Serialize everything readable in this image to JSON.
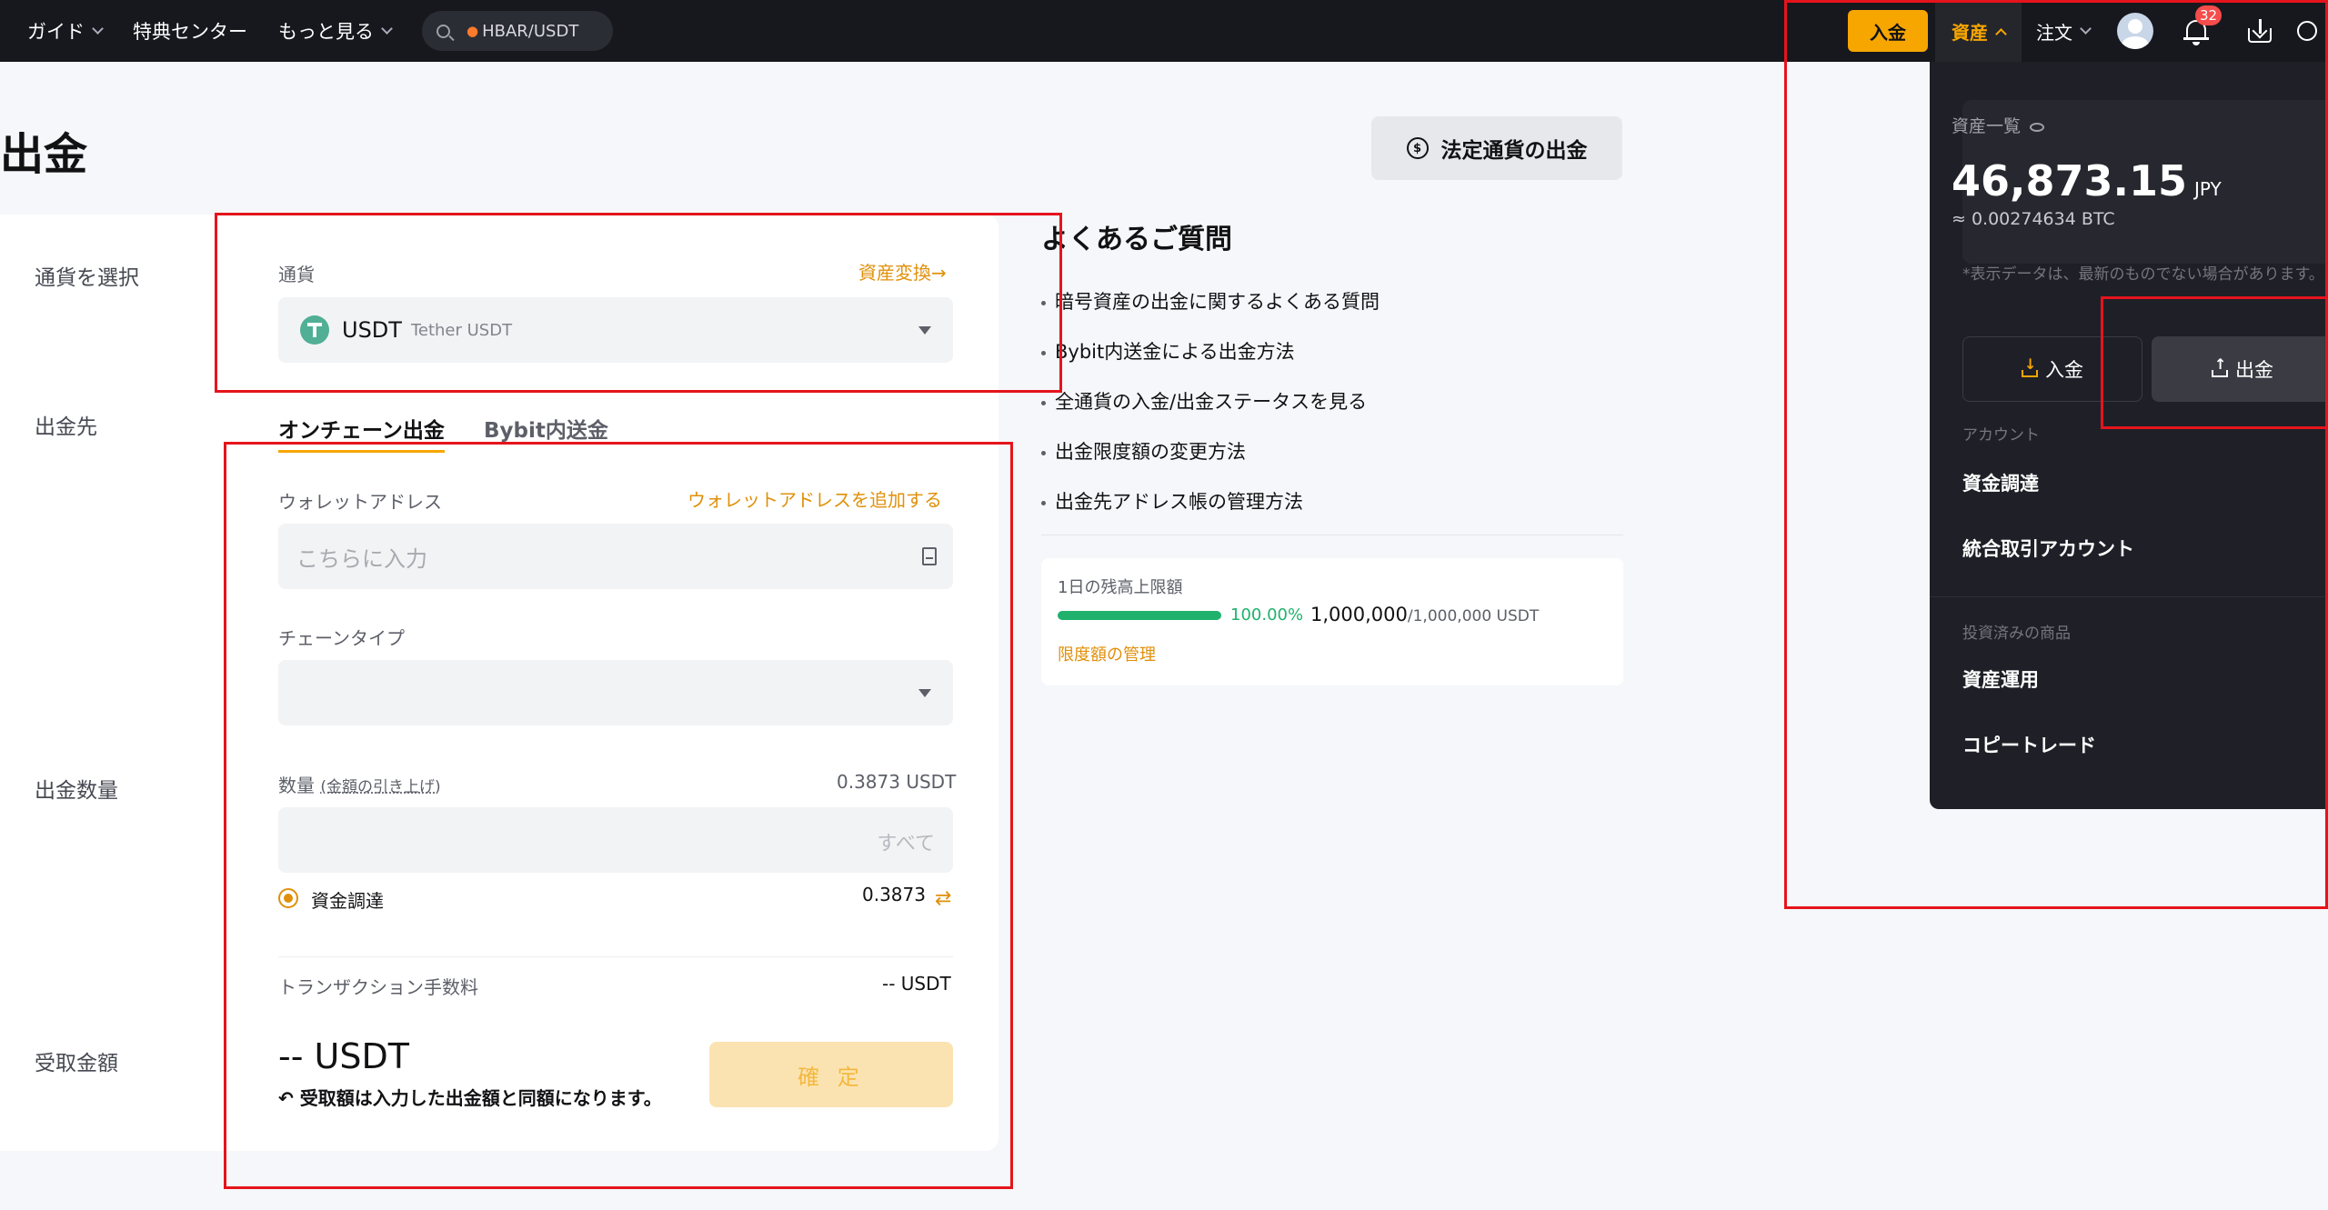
{
  "nav": {
    "guide": "ガイド",
    "rewards": "特典センター",
    "more": "もっと見る",
    "search": "HBAR/USDT",
    "deposit": "入金",
    "assets": "資産",
    "orders": "注文",
    "notif_count": "32"
  },
  "page": {
    "title": "出金",
    "fiat_button": "法定通貨の出金"
  },
  "form": {
    "select_coin_label": "通貨を選択",
    "destination_label": "出金先",
    "amount_label": "出金数量",
    "receive_label": "受取金額",
    "currency_label": "通貨",
    "convert_link": "資産変換→",
    "coin_code": "USDT",
    "coin_name": "Tether USDT",
    "tab_onchain": "オンチェーン出金",
    "tab_internal": "Bybit内送金",
    "wallet_label": "ウォレットアドレス",
    "add_wallet_link": "ウォレットアドレスを追加する",
    "wallet_placeholder": "こちらに入力",
    "chain_label": "チェーンタイプ",
    "qty_label": "数量",
    "qty_hint": "(金額の引き上げ)",
    "available": "0.3873 USDT",
    "all": "すべて",
    "funding_label": "資金調達",
    "funding_value": "0.3873",
    "fee_label": "トランザクション手数料",
    "fee_value": "-- USDT",
    "receive_amount": "-- USDT",
    "receive_note": "受取額は入力した出金額と同額になります。",
    "confirm": "確 定"
  },
  "faq": {
    "title": "よくあるご質問",
    "items": [
      "暗号資産の出金に関するよくある質問",
      "Bybit内送金による出金方法",
      "全通貨の入金/出金ステータスを見る",
      "出金限度額の変更方法",
      "出金先アドレス帳の管理方法"
    ]
  },
  "limit": {
    "label": "1日の残高上限額",
    "pct": "100.00%",
    "fill_fraction": 1.0,
    "remaining": "1,000,000",
    "total": "/1,000,000 USDT",
    "manage": "限度額の管理"
  },
  "dropdown": {
    "overview": "資産一覧",
    "amount": "46,873.15",
    "currency": "JPY",
    "btc": "≈ 0.00274634 BTC",
    "note": "*表示データは、最新のものでない場合があります。",
    "deposit": "入金",
    "withdraw": "出金",
    "account_section": "アカウント",
    "funding": "資金調達",
    "unified": "統合取引アカウント",
    "invest_section": "投資済みの商品",
    "earn": "資産運用",
    "copy": "コピートレード"
  },
  "colors": {
    "accent": "#f7a600",
    "annotation_red": "#e5141c",
    "success": "#20b26c"
  }
}
